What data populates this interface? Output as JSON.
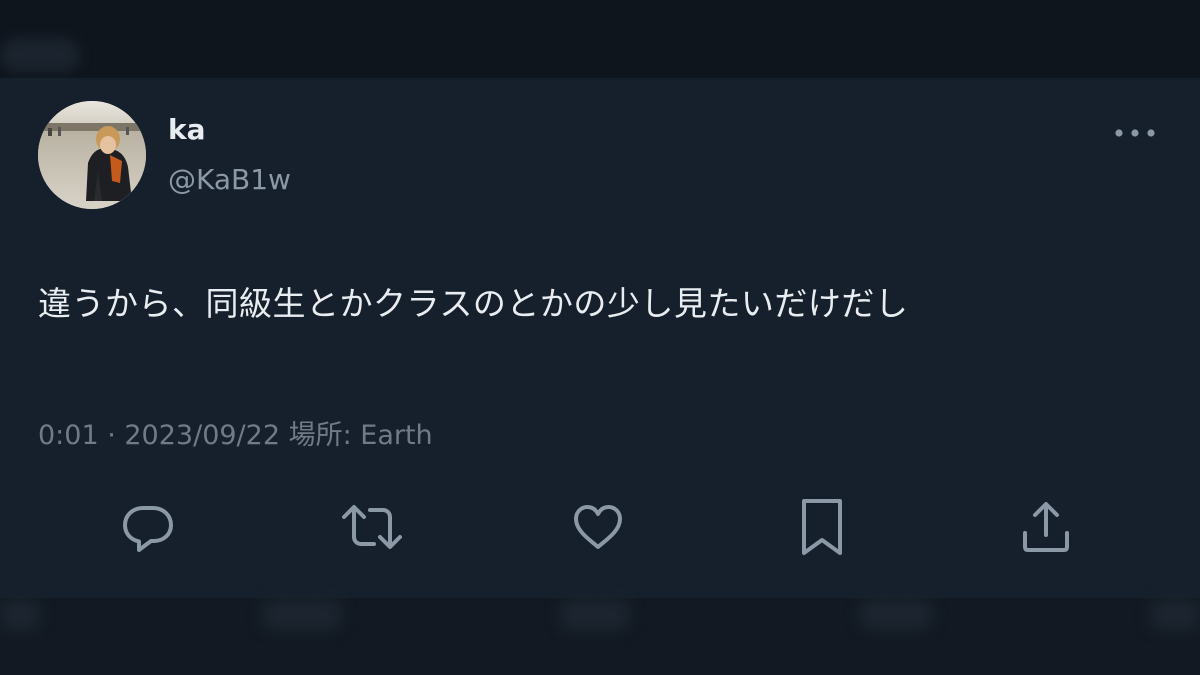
{
  "tweet": {
    "author": {
      "name": "ka",
      "handle": "@KaB1w",
      "avatar_icon": "profile-photo"
    },
    "text": "違うから、同級生とかクラスのとかの少し見たいだけだし",
    "meta": "0:01 · 2023/09/22 場所: Earth",
    "more_icon": "more-horizontal-icon"
  },
  "actions": [
    {
      "name": "reply",
      "icon": "reply-icon"
    },
    {
      "name": "retweet",
      "icon": "retweet-icon"
    },
    {
      "name": "like",
      "icon": "like-icon"
    },
    {
      "name": "bookmark",
      "icon": "bookmark-icon"
    },
    {
      "name": "share",
      "icon": "share-icon"
    }
  ],
  "colors": {
    "background": "#16202c",
    "primary_text": "#e9edf1",
    "secondary_text": "#8b98a5",
    "icon": "#8b98a5"
  }
}
